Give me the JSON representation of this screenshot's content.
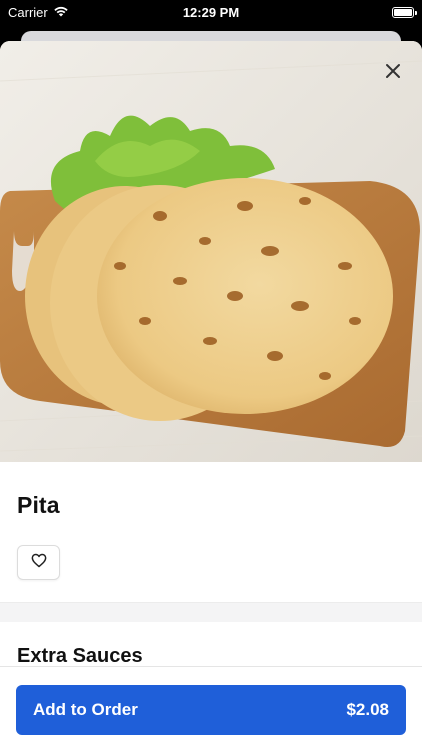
{
  "status_bar": {
    "carrier": "Carrier",
    "time": "12:29 PM",
    "icons": [
      "wifi-icon",
      "battery-icon"
    ]
  },
  "item": {
    "title": "Pita",
    "image_alt_icon": "pita-bread-image"
  },
  "actions": {
    "close_icon": "close-icon",
    "favorite_icon": "heart-icon"
  },
  "sections": {
    "extra_sauces_title": "Extra Sauces"
  },
  "footer": {
    "add_label": "Add to Order",
    "price": "$2.08"
  },
  "colors": {
    "primary": "#1f5fd9",
    "title_text": "#111111",
    "band": "#f4f4f5"
  }
}
